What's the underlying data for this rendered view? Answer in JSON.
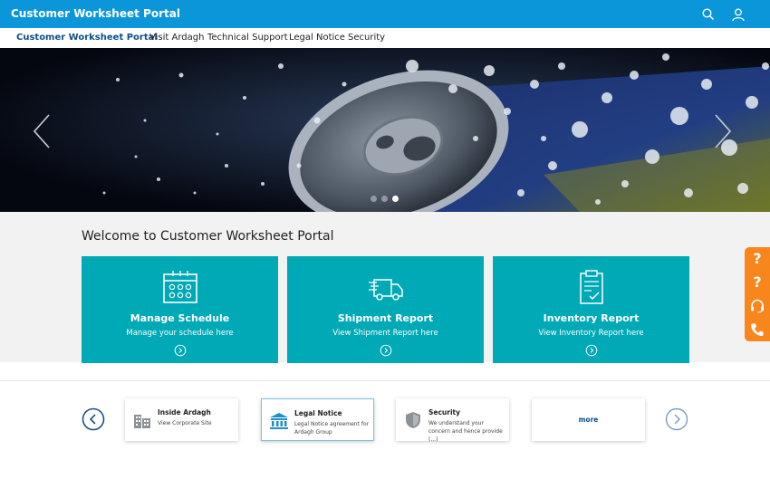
{
  "header": {
    "title": "Customer Worksheet Portal",
    "icons": [
      "search-icon",
      "user-icon"
    ]
  },
  "nav": {
    "items": [
      {
        "label": "Customer  Worksheet Portal",
        "active": true
      },
      {
        "label": "Visit Ardagh",
        "active": false
      },
      {
        "label": "Technical Support",
        "active": false
      },
      {
        "label": "Legal Notice",
        "active": false
      },
      {
        "label": "Security",
        "active": false
      }
    ]
  },
  "carousel": {
    "slide_count": 3,
    "active_index": 2,
    "icons": [
      "chevron-left-icon",
      "chevron-right-icon"
    ]
  },
  "welcome": {
    "title": "Welcome to Customer Worksheet Portal"
  },
  "tiles": [
    {
      "title": "Manage Schedule",
      "subtitle": "Manage your schedule here",
      "icon": "calendar-icon"
    },
    {
      "title": "Shipment Report",
      "subtitle": "View Shipment Report here",
      "icon": "truck-icon"
    },
    {
      "title": "Inventory Report",
      "subtitle": "View Inventory Report here",
      "icon": "clipboard-icon"
    }
  ],
  "links": [
    {
      "title": "Inside Ardagh",
      "desc": "View Corporate Site",
      "icon": "building-icon"
    },
    {
      "title": "Legal Notice",
      "desc": "Legal Notice agreement for Ardagh Group",
      "icon": "courthouse-icon"
    },
    {
      "title": "Security",
      "desc": "We understand your concern and hence provide (...)",
      "icon": "shield-icon"
    },
    {
      "more_label": "more"
    }
  ],
  "side_tabs": [
    "question-icon",
    "question-icon",
    "headset-icon",
    "phone-icon"
  ],
  "colors": {
    "header": "#0a96d8",
    "tile": "#00a9b6",
    "side_tab": "#f7861d",
    "nav_active": "#0d4f8b"
  }
}
